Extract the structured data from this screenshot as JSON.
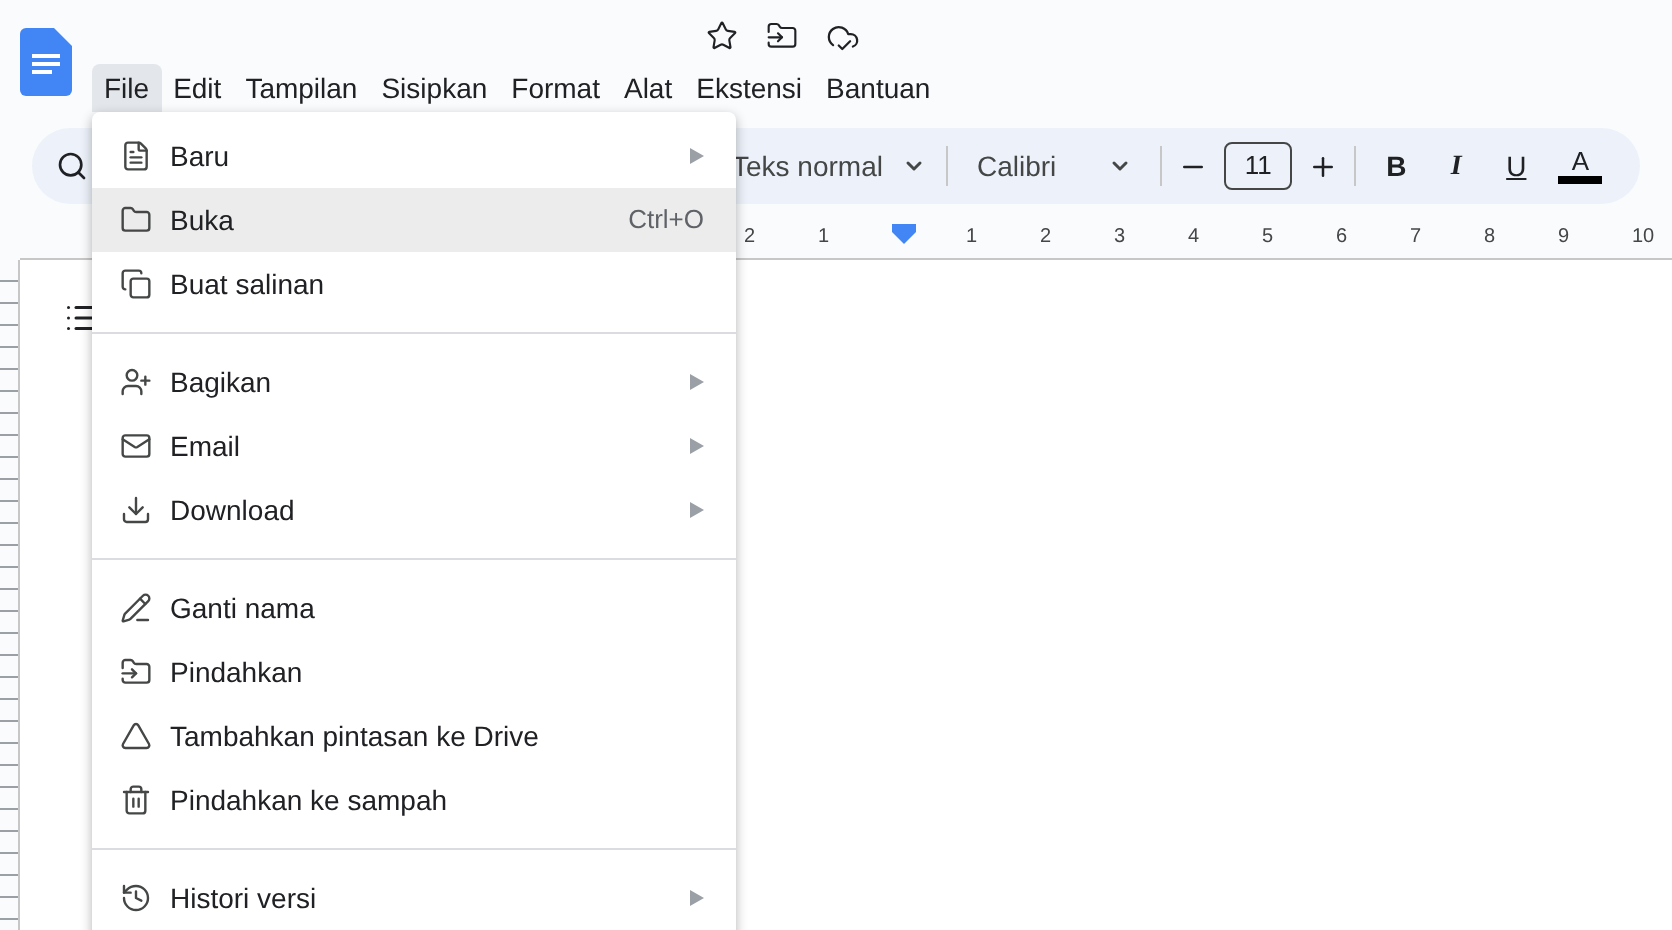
{
  "menubar": [
    {
      "label": "File",
      "selected": true
    },
    {
      "label": "Edit",
      "selected": false
    },
    {
      "label": "Tampilan",
      "selected": false
    },
    {
      "label": "Sisipkan",
      "selected": false
    },
    {
      "label": "Format",
      "selected": false
    },
    {
      "label": "Alat",
      "selected": false
    },
    {
      "label": "Ekstensi",
      "selected": false
    },
    {
      "label": "Bantuan",
      "selected": false
    }
  ],
  "toolbar": {
    "style": "Teks normal",
    "font": "Calibri",
    "font_size": "11",
    "bold": "B",
    "italic": "I",
    "underline": "U",
    "text_color": "A"
  },
  "ruler": [
    "2",
    "1",
    "1",
    "2",
    "3",
    "4",
    "5",
    "6",
    "7",
    "8",
    "9",
    "10"
  ],
  "file_menu": [
    {
      "items": [
        {
          "label": "Baru",
          "submenu": true,
          "selected": false
        },
        {
          "label": "Buka",
          "shortcut": "Ctrl+O",
          "submenu": false,
          "selected": true
        },
        {
          "label": "Buat salinan",
          "submenu": false,
          "selected": false
        }
      ]
    },
    {
      "items": [
        {
          "label": "Bagikan",
          "submenu": true,
          "selected": false
        },
        {
          "label": "Email",
          "submenu": true,
          "selected": false
        },
        {
          "label": "Download",
          "submenu": true,
          "selected": false
        }
      ]
    },
    {
      "items": [
        {
          "label": "Ganti nama",
          "submenu": false,
          "selected": false
        },
        {
          "label": "Pindahkan",
          "submenu": false,
          "selected": false
        },
        {
          "label": "Tambahkan pintasan ke Drive",
          "submenu": false,
          "selected": false
        },
        {
          "label": "Pindahkan ke sampah",
          "submenu": false,
          "selected": false
        }
      ]
    },
    {
      "items": [
        {
          "label": "Histori versi",
          "submenu": true,
          "selected": false
        }
      ]
    }
  ]
}
